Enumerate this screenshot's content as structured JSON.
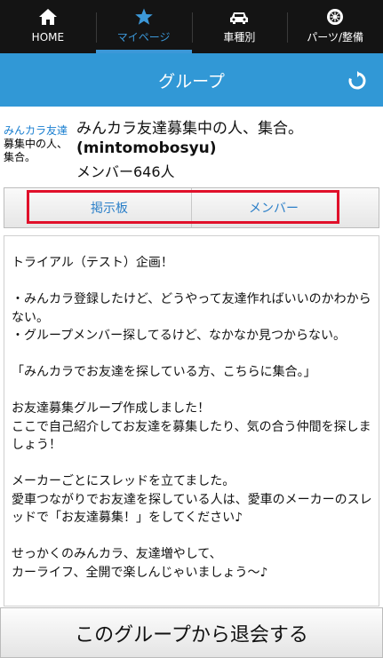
{
  "nav": [
    {
      "label": "HOME",
      "icon": "home-icon",
      "active": false
    },
    {
      "label": "マイページ",
      "icon": "star-icon",
      "active": true
    },
    {
      "label": "車種別",
      "icon": "car-icon",
      "active": false
    },
    {
      "label": "パーツ/整備",
      "icon": "tire-icon",
      "active": false
    }
  ],
  "header": {
    "title": "グループ",
    "refresh_icon": "refresh-icon"
  },
  "group": {
    "logo_lines": [
      "みんカラ友達",
      "募集中の人、",
      "集合。"
    ],
    "title": "みんカラ友達募集中の人、集合。",
    "title_id": "(mintomobosyu)",
    "members": "メンバー646人"
  },
  "tabs": {
    "board": "掲示板",
    "members": "メンバー"
  },
  "description": [
    "トライアル（テスト）企画！",
    "",
    "・みんカラ登録したけど、どうやって友達作ればいいのかわからない。",
    "・グループメンバー探してるけど、なかなか見つからない。",
    "",
    "「みんカラでお友達を探している方、こちらに集合。」",
    "",
    "お友達募集グループ作成しました！",
    "ここで自己紹介してお友達を募集したり、気の合う仲間を探しましょう！",
    "",
    "メーカーごとにスレッドを立てました。",
    "愛車つながりでお友達を探している人は、愛車のメーカーのスレッドで「お友達募集！」をしてください♪",
    "",
    "せっかくのみんカラ、友達増やして、",
    "カーライフ、全開で楽しんじゃいましょう〜♪"
  ],
  "leave_button": "このグループから退会する",
  "colors": {
    "accent": "#3198d6",
    "nav_bg": "#141414",
    "highlight": "#e0102a",
    "tab_text": "#2b7fc8"
  }
}
